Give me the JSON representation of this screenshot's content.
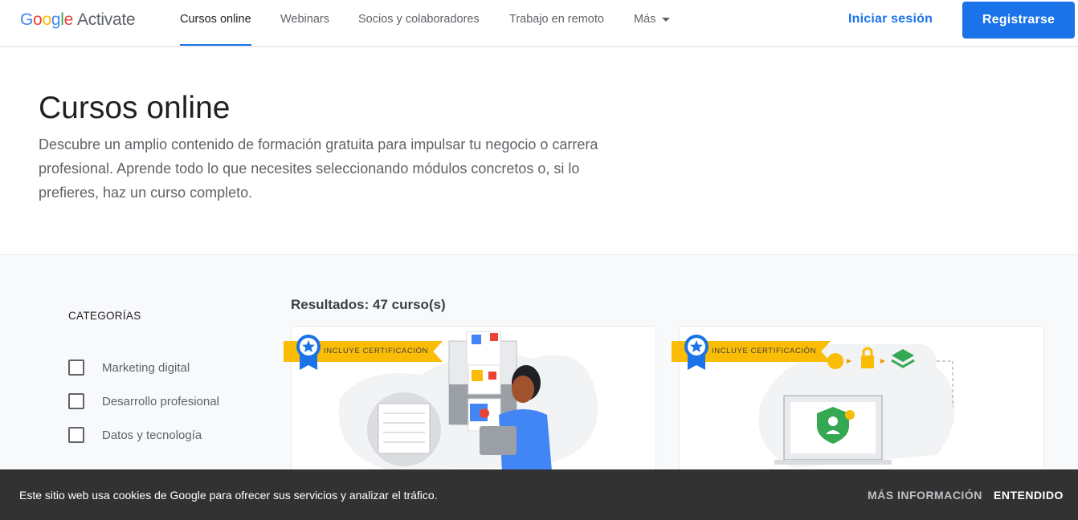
{
  "header": {
    "logo": {
      "g1": "G",
      "g2": "o",
      "g3": "o",
      "g4": "g",
      "g5": "l",
      "g6": "e",
      "product": "Activate"
    },
    "nav": [
      {
        "label": "Cursos online",
        "active": true
      },
      {
        "label": "Webinars"
      },
      {
        "label": "Socios y colaboradores"
      },
      {
        "label": "Trabajo en remoto"
      },
      {
        "label": "Más"
      }
    ],
    "signin_label": "Iniciar sesión",
    "register_label": "Registrarse"
  },
  "hero": {
    "title": "Cursos online",
    "description": "Descubre un amplio contenido de formación gratuita para impulsar tu negocio o carrera profesional. Aprende todo lo que necesites seleccionando módulos concretos o, si lo prefieres, haz un curso completo."
  },
  "sidebar": {
    "title": "CATEGORÍAS",
    "categories": [
      {
        "label": "Marketing digital",
        "checked": false
      },
      {
        "label": "Desarrollo profesional",
        "checked": false
      },
      {
        "label": "Datos y tecnología",
        "checked": false
      }
    ]
  },
  "results": {
    "label": "Resultados: 47 curso(s)"
  },
  "cards": [
    {
      "badge": "INCLUYE CERTIFICACIÓN"
    },
    {
      "badge": "INCLUYE CERTIFICACIÓN"
    }
  ],
  "cookie_bar": {
    "text": "Este sitio web usa cookies de Google para ofrecer sus servicios y analizar el tráfico.",
    "more_label": "MÁS INFORMACIÓN",
    "ok_label": "ENTENDIDO"
  },
  "colors": {
    "accent": "#1a73e8",
    "badge": "#fbbc05",
    "cookie_bg": "#323232"
  }
}
